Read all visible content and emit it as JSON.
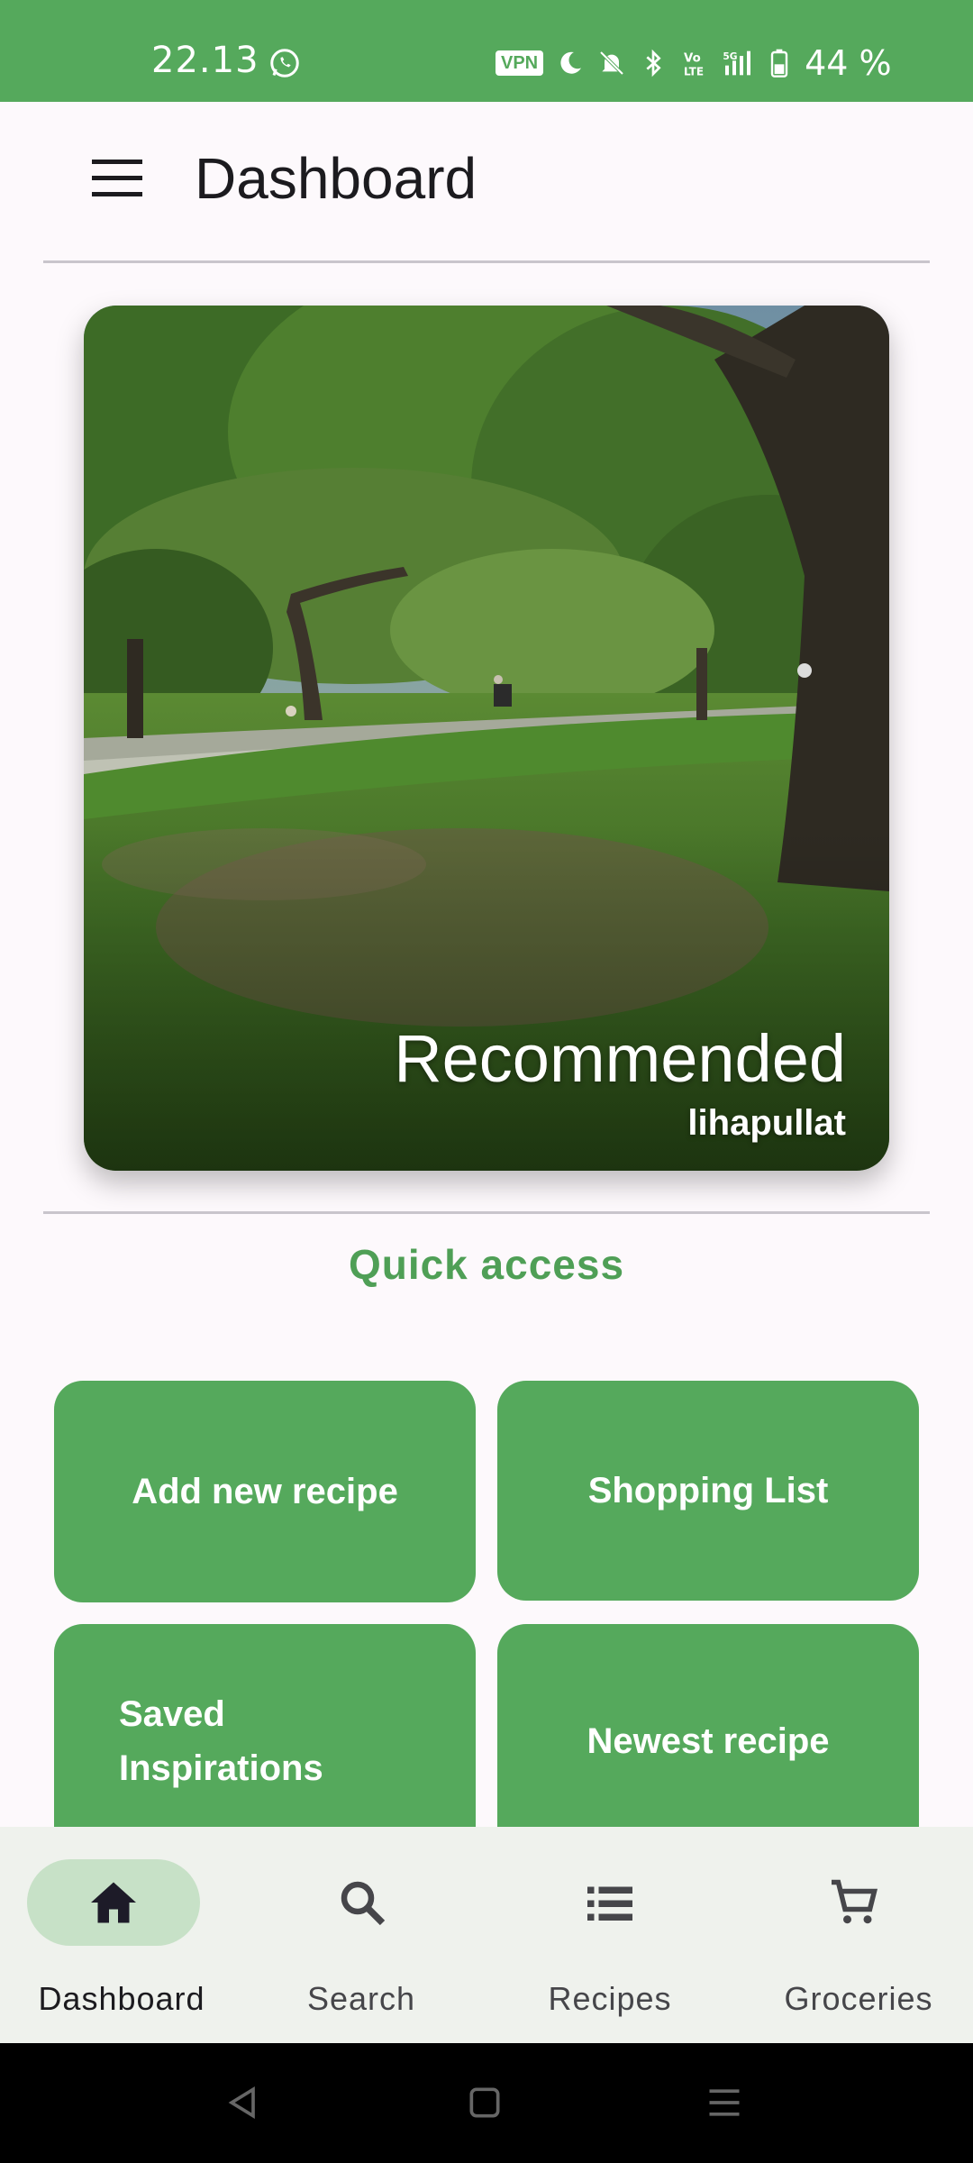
{
  "status_bar": {
    "time": "22.13",
    "vpn_label": "VPN",
    "battery": "44 %",
    "icons": [
      "whatsapp-icon",
      "moon-icon",
      "bell-off-icon",
      "bluetooth-icon",
      "volte-icon",
      "signal-5g-icon",
      "battery-icon"
    ],
    "background": "#55a95c"
  },
  "app_bar": {
    "title": "Dashboard",
    "menu_icon": "hamburger-menu-icon"
  },
  "recommended": {
    "title": "Recommended",
    "subtitle": "lihapullat"
  },
  "quick_access": {
    "title": "Quick access",
    "buttons": [
      {
        "label": "Add new recipe"
      },
      {
        "label": "Shopping List"
      },
      {
        "label": "Saved Inspirations"
      },
      {
        "label": "Newest recipe"
      }
    ],
    "accent": "#55a95c"
  },
  "bottom_nav": {
    "items": [
      {
        "label": "Dashboard",
        "icon": "home-icon",
        "active": true
      },
      {
        "label": "Search",
        "icon": "search-icon",
        "active": false
      },
      {
        "label": "Recipes",
        "icon": "list-icon",
        "active": false
      },
      {
        "label": "Groceries",
        "icon": "cart-icon",
        "active": false
      }
    ]
  }
}
